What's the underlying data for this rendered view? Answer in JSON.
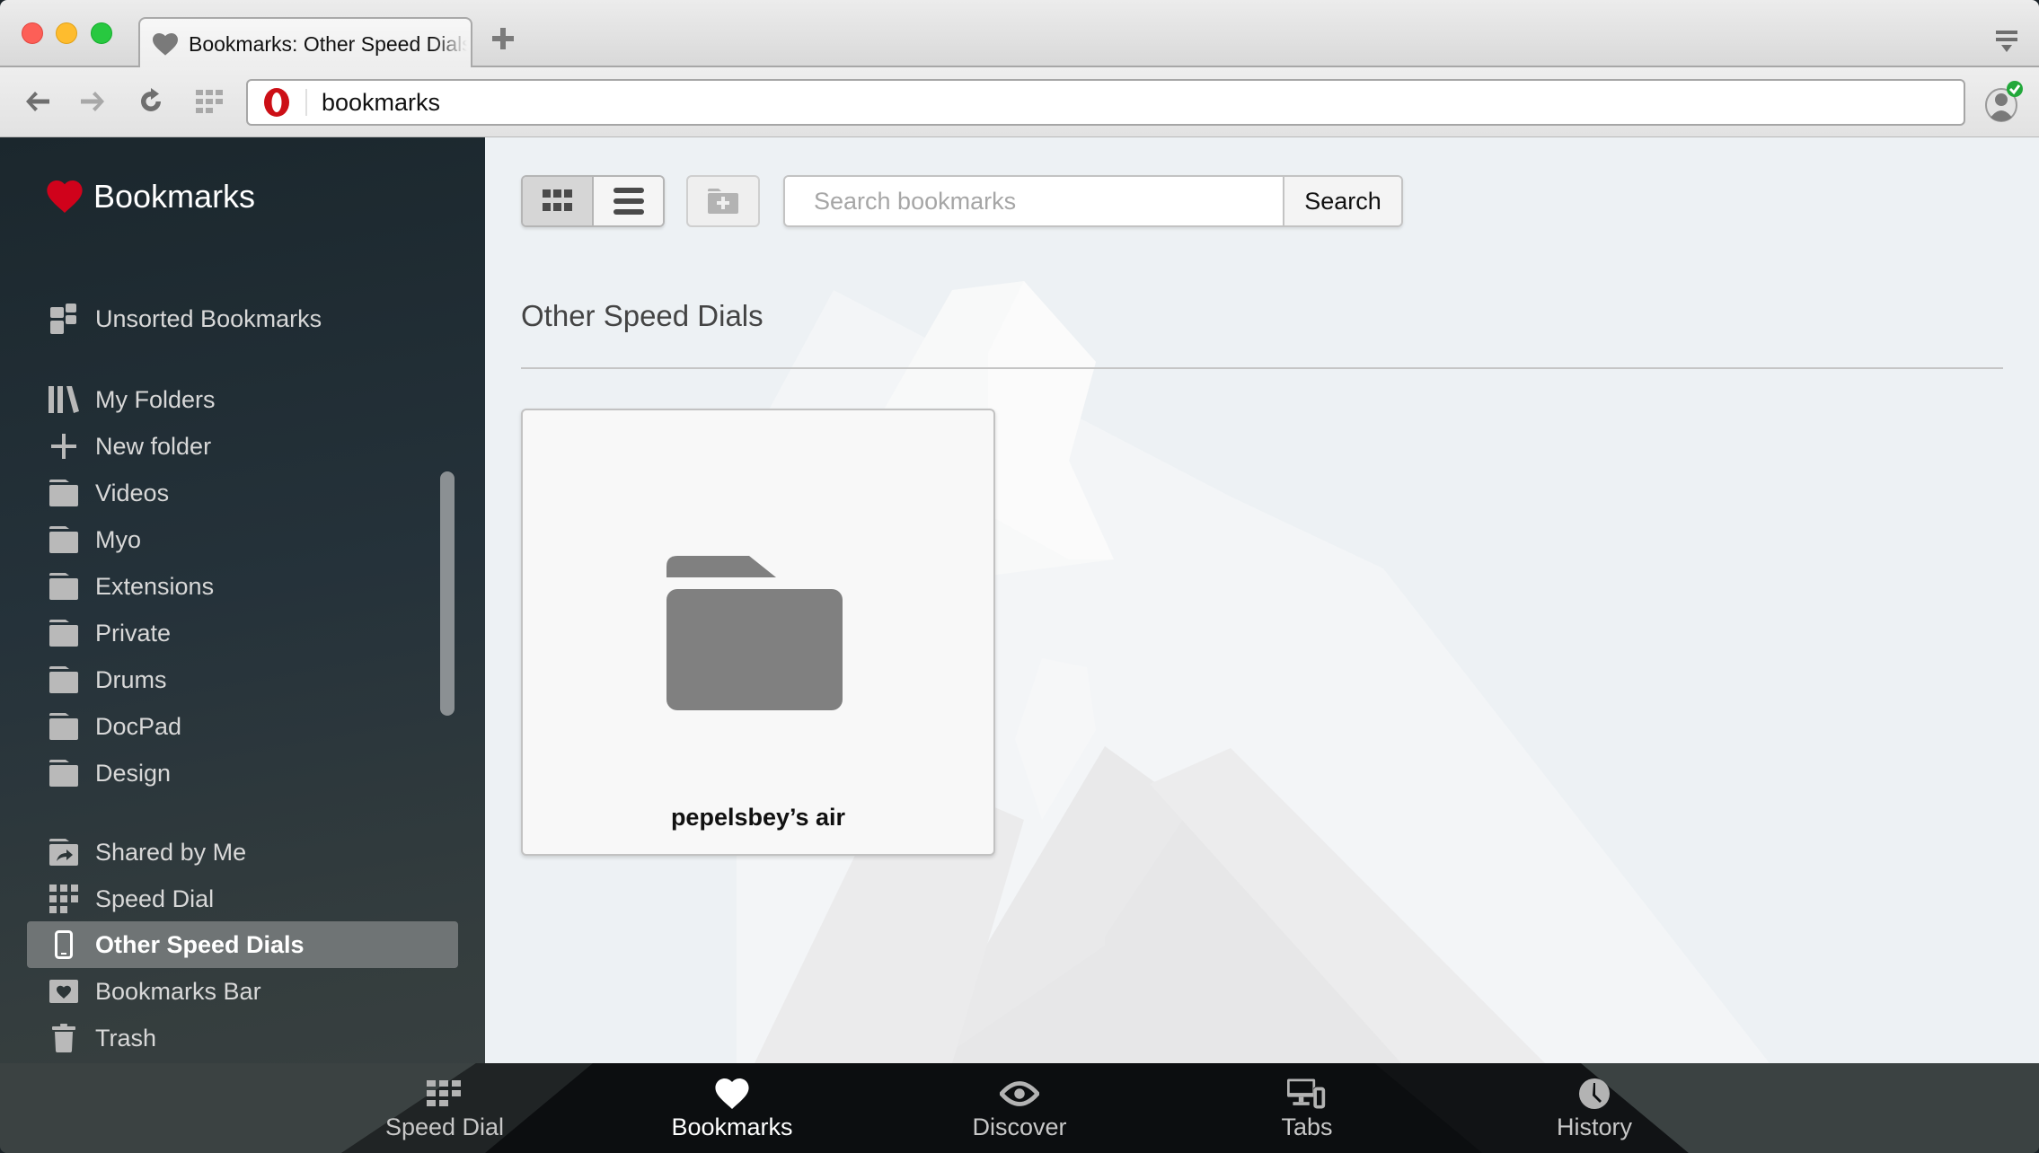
{
  "window": {
    "tab_title": "Bookmarks: Other Speed Dials",
    "tab_icon": "heart-icon",
    "new_tab_icon": "plus-icon",
    "tab_menu_icon": "tab-menu-icon"
  },
  "toolbar": {
    "back_icon": "arrow-left-icon",
    "forward_icon": "arrow-right-icon",
    "reload_icon": "reload-icon",
    "speed_dial_icon": "grid-icon",
    "address_value": "bookmarks",
    "address_icon": "opera-logo-icon",
    "profile_icon": "profile-sync-icon",
    "profile_status_color": "#2db52d"
  },
  "sidebar": {
    "brand_label": "Bookmarks",
    "brand_color": "#d0021b",
    "items": [
      {
        "label": "Unsorted Bookmarks",
        "icon": "unsorted-icon"
      },
      {
        "label": "My Folders",
        "icon": "library-icon"
      },
      {
        "label": "New folder",
        "icon": "plus-icon"
      },
      {
        "label": "Videos",
        "icon": "folder-icon"
      },
      {
        "label": "Myo",
        "icon": "folder-icon"
      },
      {
        "label": "Extensions",
        "icon": "folder-icon"
      },
      {
        "label": "Private",
        "icon": "folder-icon"
      },
      {
        "label": "Drums",
        "icon": "folder-icon"
      },
      {
        "label": "DocPad",
        "icon": "folder-icon"
      },
      {
        "label": "Design",
        "icon": "folder-icon"
      },
      {
        "label": "Shared by Me",
        "icon": "shared-folder-icon"
      },
      {
        "label": "Speed Dial",
        "icon": "speed-dial-icon"
      },
      {
        "label": "Other Speed Dials",
        "icon": "phone-icon",
        "active": true
      },
      {
        "label": "Bookmarks Bar",
        "icon": "bookmarks-bar-icon"
      },
      {
        "label": "Trash",
        "icon": "trash-icon"
      }
    ]
  },
  "main": {
    "view_grid_icon": "grid-view-icon",
    "view_list_icon": "list-view-icon",
    "view_mode": "grid",
    "new_folder_icon": "new-folder-icon",
    "search_placeholder": "Search bookmarks",
    "search_value": "",
    "search_button": "Search",
    "section_title": "Other Speed Dials",
    "tiles": [
      {
        "label": "pepelsbey’s air",
        "icon": "folder-icon"
      }
    ]
  },
  "bottom_nav": {
    "items": [
      {
        "label": "Speed Dial",
        "icon": "speed-dial-icon"
      },
      {
        "label": "Bookmarks",
        "icon": "heart-icon",
        "active": true
      },
      {
        "label": "Discover",
        "icon": "eye-icon"
      },
      {
        "label": "Tabs",
        "icon": "devices-icon"
      },
      {
        "label": "History",
        "icon": "clock-icon"
      }
    ]
  }
}
